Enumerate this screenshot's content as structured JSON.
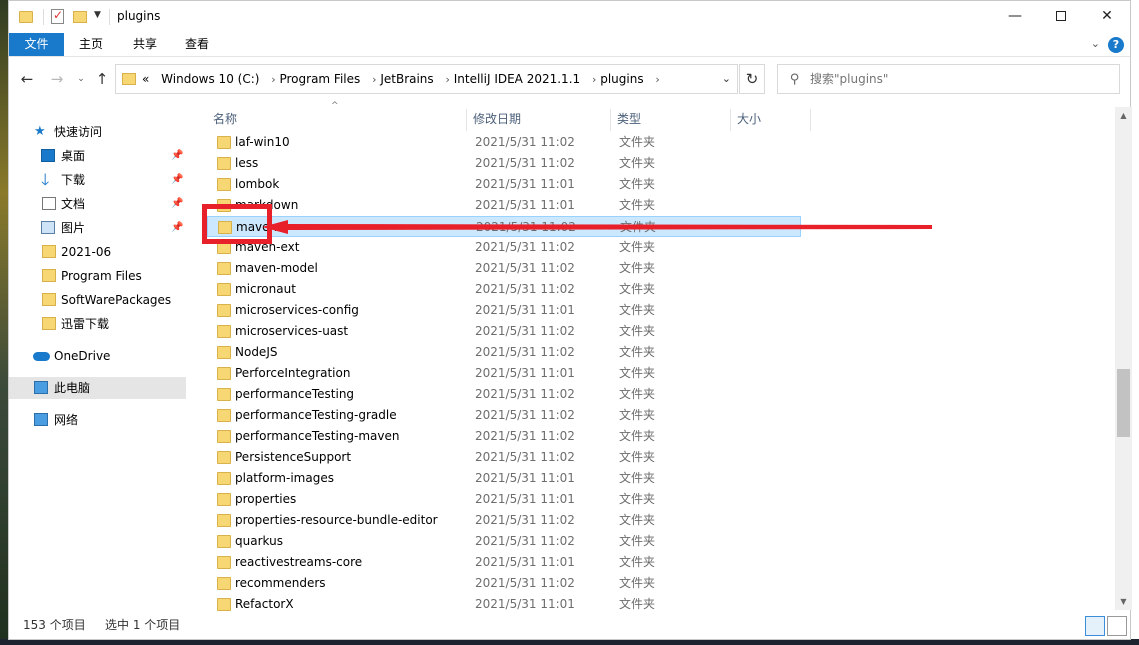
{
  "title": "plugins",
  "ribbon": {
    "file": "文件",
    "home": "主页",
    "share": "共享",
    "view": "查看",
    "help": "?"
  },
  "nav": {
    "crumbs": [
      "Windows 10 (C:)",
      "Program Files",
      "JetBrains",
      "IntelliJ IDEA 2021.1.1",
      "plugins"
    ],
    "prefix": "«",
    "search_placeholder": "搜索\"plugins\""
  },
  "sidebar": {
    "items": [
      {
        "label": "快速访问"
      },
      {
        "label": "桌面"
      },
      {
        "label": "下载"
      },
      {
        "label": "文档"
      },
      {
        "label": "图片"
      },
      {
        "label": "2021-06"
      },
      {
        "label": "Program Files"
      },
      {
        "label": "SoftWarePackages"
      },
      {
        "label": "迅雷下载"
      },
      {
        "label": "OneDrive"
      },
      {
        "label": "此电脑"
      },
      {
        "label": "网络"
      }
    ]
  },
  "columns": {
    "name": "名称",
    "date": "修改日期",
    "type": "类型",
    "size": "大小"
  },
  "files": [
    {
      "name": "laf-win10",
      "date": "2021/5/31 11:02",
      "type": "文件夹"
    },
    {
      "name": "less",
      "date": "2021/5/31 11:02",
      "type": "文件夹"
    },
    {
      "name": "lombok",
      "date": "2021/5/31 11:01",
      "type": "文件夹"
    },
    {
      "name": "markdown",
      "date": "2021/5/31 11:01",
      "type": "文件夹"
    },
    {
      "name": "maven",
      "date": "2021/5/31 11:02",
      "type": "文件夹"
    },
    {
      "name": "maven-ext",
      "date": "2021/5/31 11:02",
      "type": "文件夹"
    },
    {
      "name": "maven-model",
      "date": "2021/5/31 11:02",
      "type": "文件夹"
    },
    {
      "name": "micronaut",
      "date": "2021/5/31 11:02",
      "type": "文件夹"
    },
    {
      "name": "microservices-config",
      "date": "2021/5/31 11:01",
      "type": "文件夹"
    },
    {
      "name": "microservices-uast",
      "date": "2021/5/31 11:02",
      "type": "文件夹"
    },
    {
      "name": "NodeJS",
      "date": "2021/5/31 11:02",
      "type": "文件夹"
    },
    {
      "name": "PerforceIntegration",
      "date": "2021/5/31 11:01",
      "type": "文件夹"
    },
    {
      "name": "performanceTesting",
      "date": "2021/5/31 11:02",
      "type": "文件夹"
    },
    {
      "name": "performanceTesting-gradle",
      "date": "2021/5/31 11:02",
      "type": "文件夹"
    },
    {
      "name": "performanceTesting-maven",
      "date": "2021/5/31 11:02",
      "type": "文件夹"
    },
    {
      "name": "PersistenceSupport",
      "date": "2021/5/31 11:02",
      "type": "文件夹"
    },
    {
      "name": "platform-images",
      "date": "2021/5/31 11:01",
      "type": "文件夹"
    },
    {
      "name": "properties",
      "date": "2021/5/31 11:01",
      "type": "文件夹"
    },
    {
      "name": "properties-resource-bundle-editor",
      "date": "2021/5/31 11:02",
      "type": "文件夹"
    },
    {
      "name": "quarkus",
      "date": "2021/5/31 11:02",
      "type": "文件夹"
    },
    {
      "name": "reactivestreams-core",
      "date": "2021/5/31 11:01",
      "type": "文件夹"
    },
    {
      "name": "recommenders",
      "date": "2021/5/31 11:02",
      "type": "文件夹"
    },
    {
      "name": "RefactorX",
      "date": "2021/5/31 11:01",
      "type": "文件夹"
    }
  ],
  "status": {
    "count": "153 个项目",
    "selected": "选中 1 个项目"
  },
  "colors": {
    "accent": "#1979ca",
    "selection": "#cce8ff",
    "annotation": "#e8202a"
  },
  "icons": [
    "folder-icon",
    "back-icon",
    "forward-icon",
    "up-icon",
    "refresh-icon",
    "search-icon",
    "star-icon",
    "desktop-icon",
    "download-icon",
    "document-icon",
    "picture-icon",
    "onedrive-icon",
    "pc-icon",
    "network-icon"
  ]
}
